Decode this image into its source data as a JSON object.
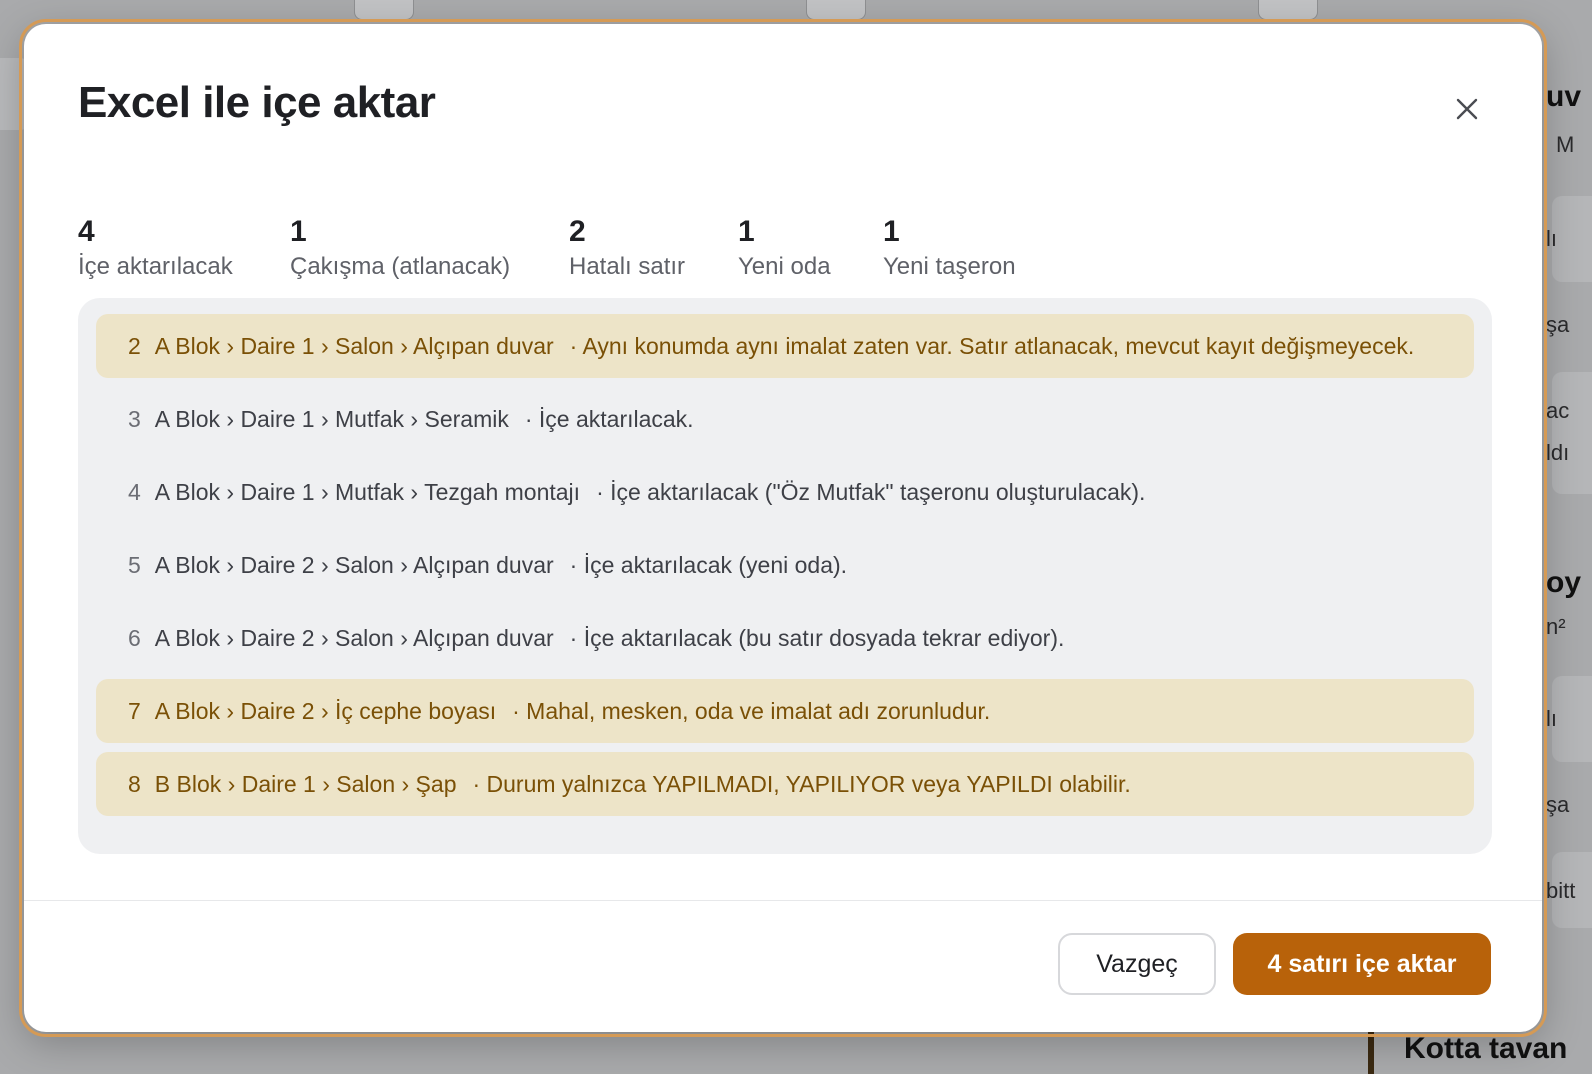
{
  "background": {
    "fragments": [
      "uv",
      "M",
      "lı",
      "şa",
      "ac",
      "ldı",
      "oy",
      "n²",
      "lı",
      "şa",
      "bitt",
      "Kotta tavan"
    ]
  },
  "modal": {
    "title": "Excel ile içe aktar",
    "close_icon": "close-icon",
    "stats": [
      {
        "value": "4",
        "label": "İçe aktarılacak"
      },
      {
        "value": "1",
        "label": "Çakışma (atlanacak)"
      },
      {
        "value": "2",
        "label": "Hatalı satır"
      },
      {
        "value": "1",
        "label": "Yeni oda"
      },
      {
        "value": "1",
        "label": "Yeni taşeron"
      }
    ],
    "rows": [
      {
        "num": "2",
        "path": "A Blok › Daire 1 › Salon › Alçıpan duvar",
        "message": "· Aynı konumda aynı imalat zaten var. Satır atlanacak, mevcut kayıt değişmeyecek.",
        "status": "warning"
      },
      {
        "num": "3",
        "path": "A Blok › Daire 1 › Mutfak › Seramik",
        "message": "· İçe aktarılacak.",
        "status": "ok"
      },
      {
        "num": "4",
        "path": "A Blok › Daire 1 › Mutfak › Tezgah montajı",
        "message": "· İçe aktarılacak (\"Öz Mutfak\" taşeronu oluşturulacak).",
        "status": "ok"
      },
      {
        "num": "5",
        "path": "A Blok › Daire 2 › Salon › Alçıpan duvar",
        "message": "· İçe aktarılacak (yeni oda).",
        "status": "ok"
      },
      {
        "num": "6",
        "path": "A Blok › Daire 2 › Salon › Alçıpan duvar",
        "message": "· İçe aktarılacak (bu satır dosyada tekrar ediyor).",
        "status": "ok"
      },
      {
        "num": "7",
        "path": "A Blok › Daire 2 › İç cephe boyası",
        "message": "· Mahal, mesken, oda ve imalat adı zorunludur.",
        "status": "warning"
      },
      {
        "num": "8",
        "path": "B Blok › Daire 1 › Salon › Şap",
        "message": "· Durum yalnızca YAPILMADI, YAPILIYOR veya YAPILDI olabilir.",
        "status": "warning"
      }
    ],
    "cancel_label": "Vazgeç",
    "submit_label": "4 satırı içe aktar"
  },
  "colors": {
    "accent": "#b8620a",
    "warning_bg": "#ede4c8",
    "warning_text": "#7a5006",
    "panel_bg": "#eff0f2",
    "overlay": "#a9aaac"
  }
}
